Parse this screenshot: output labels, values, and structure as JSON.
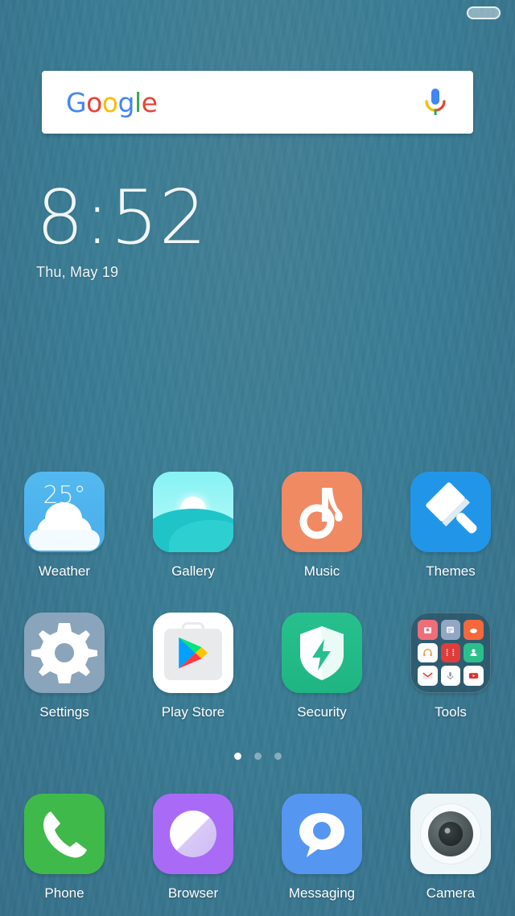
{
  "status_bar": {
    "battery_icon": "battery-icon"
  },
  "search_widget": {
    "brand": "Google",
    "brand_letters": [
      "G",
      "o",
      "o",
      "g",
      "l",
      "e"
    ],
    "mic_icon": "microphone-icon"
  },
  "clock_widget": {
    "time": "8:52",
    "date": "Thu, May 19"
  },
  "home_rows": [
    {
      "row_name": "row-1",
      "apps": [
        {
          "label": "Weather",
          "icon": "weather-icon",
          "badge": "25°",
          "color": "#4aaeeb"
        },
        {
          "label": "Gallery",
          "icon": "gallery-icon",
          "color": "#1ec4c8"
        },
        {
          "label": "Music",
          "icon": "music-icon",
          "color": "#f08a63"
        },
        {
          "label": "Themes",
          "icon": "themes-icon",
          "color": "#2196e8"
        }
      ]
    },
    {
      "row_name": "row-2",
      "apps": [
        {
          "label": "Settings",
          "icon": "settings-icon",
          "color": "#8aa4bb"
        },
        {
          "label": "Play Store",
          "icon": "play-store-icon",
          "color": "#ffffff"
        },
        {
          "label": "Security",
          "icon": "security-icon",
          "color": "#1fb583"
        },
        {
          "label": "Tools",
          "icon": "folder-icon",
          "color": "#264a5c"
        }
      ]
    }
  ],
  "tools_folder": {
    "label": "Tools",
    "mini_icons": [
      {
        "name": "mi-video-player-icon",
        "color": "#ef6e7a"
      },
      {
        "name": "mi-notes-icon",
        "color": "#93a7c4"
      },
      {
        "name": "mi-weather-mini-icon",
        "color": "#f4683c"
      },
      {
        "name": "mi-music-headphones-icon",
        "color": "#fdfdfd"
      },
      {
        "name": "mi-film-icon",
        "color": "#e03c3c"
      },
      {
        "name": "mi-contacts-icon",
        "color": "#2bbf8c"
      },
      {
        "name": "mi-gmail-icon",
        "color": "#fdfdfd"
      },
      {
        "name": "mi-recorder-icon",
        "color": "#fdfdfd"
      },
      {
        "name": "mi-youtube-icon",
        "color": "#fdfdfd"
      }
    ]
  },
  "page_indicator": {
    "total": 3,
    "active_index": 0
  },
  "dock": {
    "apps": [
      {
        "label": "Phone",
        "icon": "phone-icon",
        "color": "#3fb94a"
      },
      {
        "label": "Browser",
        "icon": "browser-icon",
        "color": "#a96bf5"
      },
      {
        "label": "Messaging",
        "icon": "messaging-icon",
        "color": "#5496f0"
      },
      {
        "label": "Camera",
        "icon": "camera-icon",
        "color": "#eef6fa"
      }
    ]
  },
  "theme": {
    "wallpaper_color": "#3a7e96",
    "label_color": "#ffffff"
  }
}
